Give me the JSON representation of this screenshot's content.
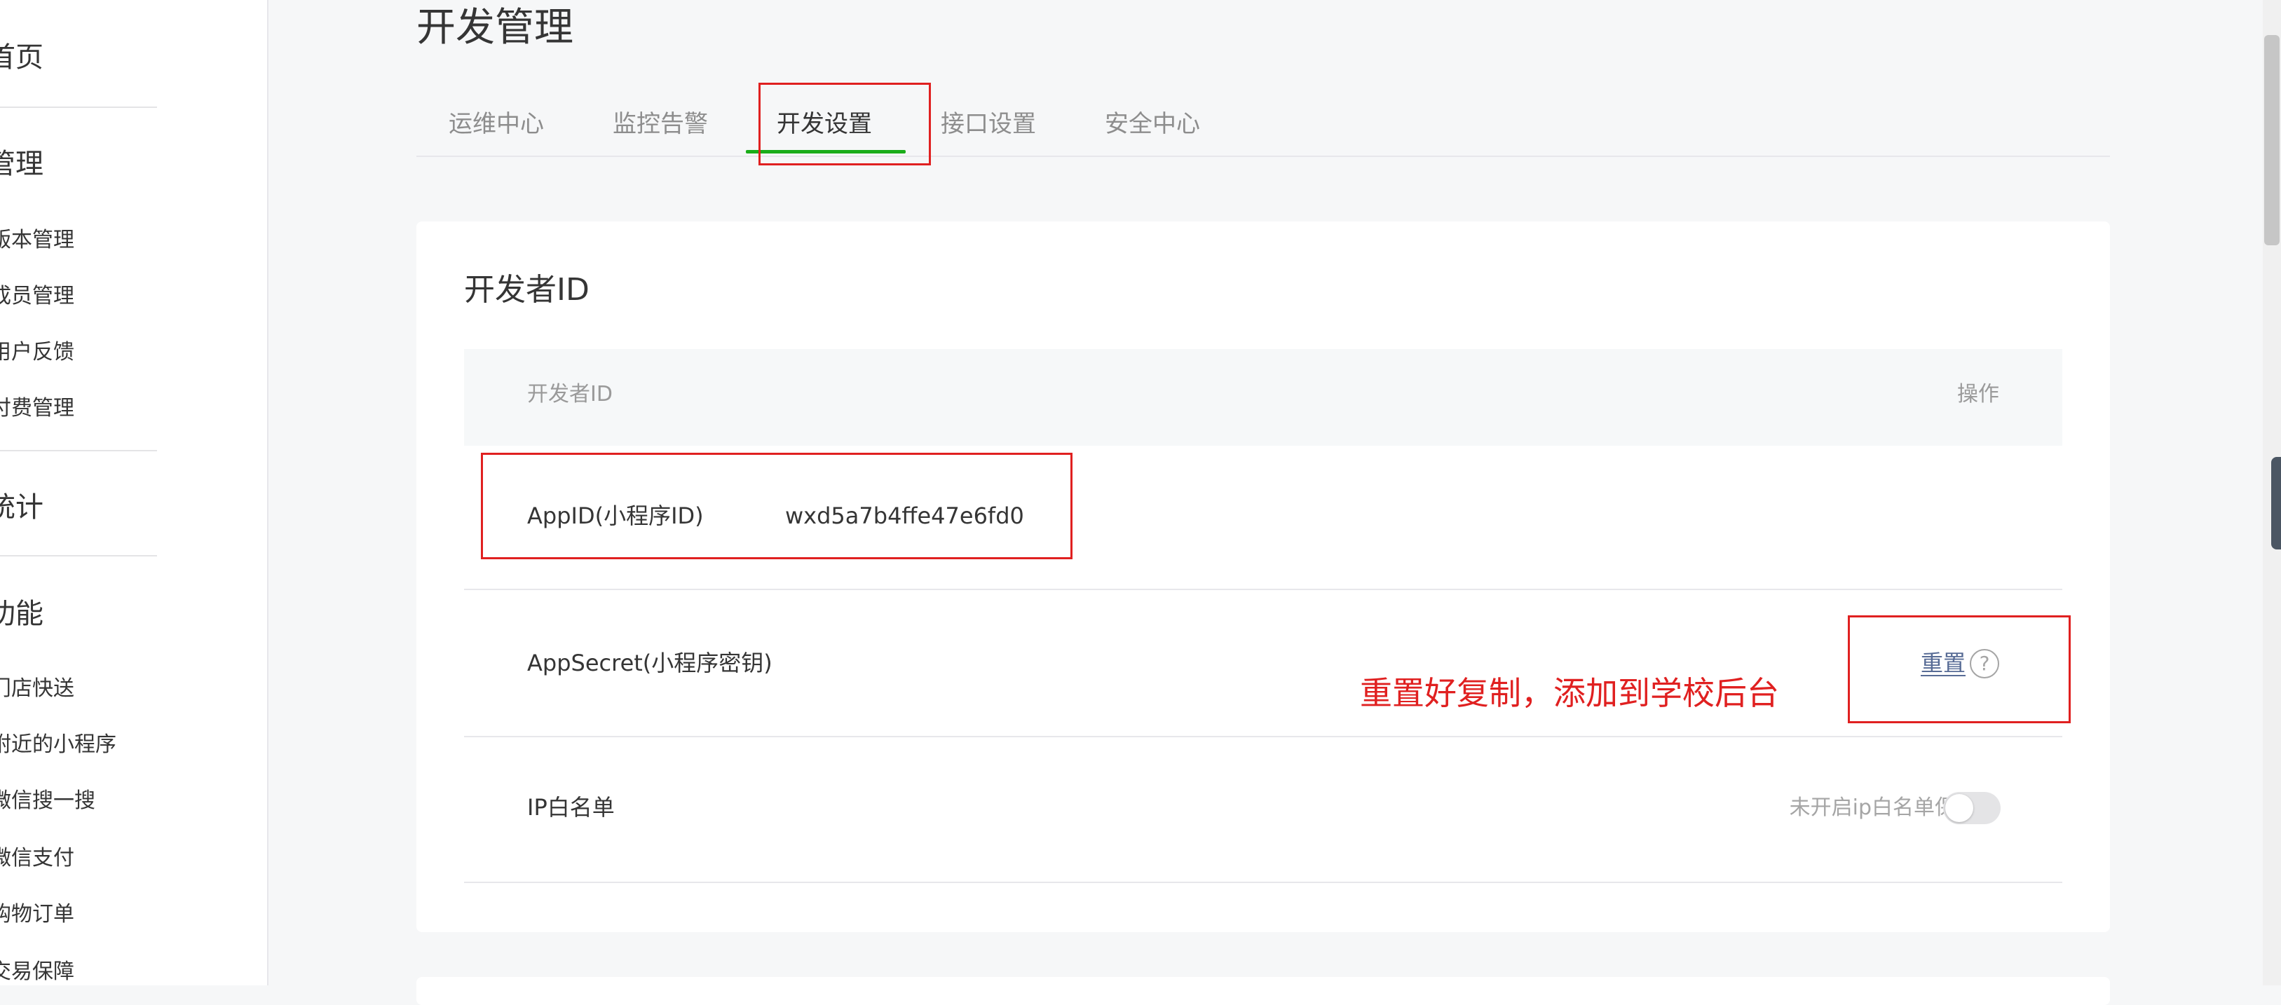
{
  "sidebar": {
    "headings": [
      "首页",
      "管理",
      "统计",
      "功能"
    ],
    "manage_items": [
      "版本管理",
      "成员管理",
      "用户反馈",
      "付费管理"
    ],
    "function_items": [
      "门店快送",
      "附近的小程序",
      "微信搜一搜",
      "微信支付",
      "购物订单",
      "交易保障"
    ]
  },
  "page": {
    "title": "开发管理"
  },
  "tabs": [
    {
      "label": "运维中心",
      "active": false
    },
    {
      "label": "监控告警",
      "active": false
    },
    {
      "label": "开发设置",
      "active": true
    },
    {
      "label": "接口设置",
      "active": false
    },
    {
      "label": "安全中心",
      "active": false
    }
  ],
  "dev_id_card": {
    "title": "开发者ID",
    "columns": {
      "id": "开发者ID",
      "action": "操作"
    },
    "rows": {
      "appid": {
        "label": "AppID(小程序ID)",
        "value": "wxd5a7b4ffe47e6fd0"
      },
      "appsecret": {
        "label": "AppSecret(小程序密钥)",
        "action": "重置",
        "help_icon": "?"
      },
      "ip_whitelist": {
        "label": "IP白名单",
        "status": "未开启ip白名单保护",
        "enabled": false
      }
    }
  },
  "annotation": {
    "note": "重置好复制，添加到学校后台",
    "color": "#e02020"
  },
  "colors": {
    "accent_green": "#1aad19",
    "link_blue": "#576b95"
  }
}
